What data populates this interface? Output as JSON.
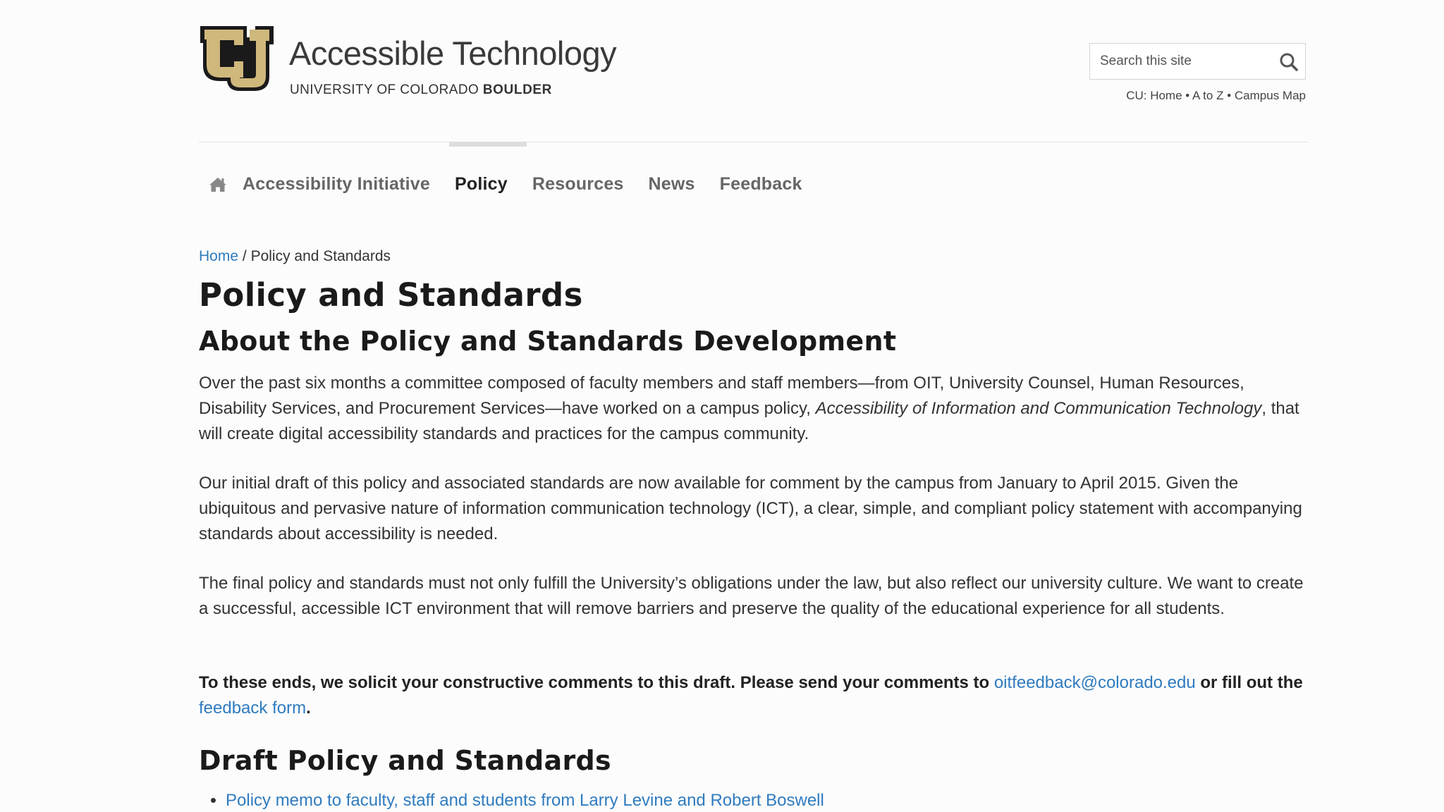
{
  "header": {
    "site_title": "Accessible Technology",
    "subtitle_prefix": "UNIVERSITY OF COLORADO ",
    "subtitle_strong": "BOULDER",
    "logo_icon": "cu-logo-icon",
    "search": {
      "placeholder": "Search this site",
      "button_icon": "search-icon"
    },
    "cu_links": {
      "prefix": "CU:",
      "items": [
        "Home",
        "A to Z",
        "Campus Map"
      ],
      "separator": "•"
    }
  },
  "nav": {
    "home_icon": "home-icon",
    "items": [
      {
        "label": "Accessibility Initiative",
        "active": false
      },
      {
        "label": "Policy",
        "active": true
      },
      {
        "label": "Resources",
        "active": false
      },
      {
        "label": "News",
        "active": false
      },
      {
        "label": "Feedback",
        "active": false
      }
    ]
  },
  "breadcrumb": {
    "home": "Home",
    "separator": "/",
    "current": "Policy and Standards"
  },
  "content": {
    "page_title": "Policy and Standards",
    "section1_heading": "About the Policy and Standards Development",
    "para1_before_italic": "Over the past six months a committee composed of faculty members and staff members—from OIT, University Counsel, Human Resources, Disability Services, and Procurement Services—have worked on a campus policy, ",
    "para1_italic": "Accessibility of Information and Communication Technology",
    "para1_after_italic": ", that will create digital accessibility standards and practices for the campus community.",
    "para2": "Our initial draft of this policy and associated standards are now available for comment by the campus from January to April 2015. Given the ubiquitous and pervasive nature of information communication technology (ICT), a clear, simple, and compliant policy statement with accompanying standards about accessibility is needed.",
    "para3": "The final policy and standards must not only fulfill the University’s obligations under the law, but also reflect our university culture. We want to create a successful, accessible ICT environment that will remove barriers and preserve the quality of the educational experience for all students.",
    "para4_before_email": "To these ends, we solicit your constructive comments to this draft. Please send your comments to ",
    "para4_email": "oitfeedback@colorado.edu",
    "para4_middle": " or fill out the ",
    "para4_link": "feedback form",
    "para4_end": ".",
    "section2_heading": "Draft Policy and Standards",
    "draft_items": [
      "Policy memo to faculty, staff and students from Larry Levine and Robert Boswell"
    ]
  },
  "colors": {
    "link": "#2f7bbf",
    "logo_gold": "#cfb87c",
    "logo_black": "#1a1a1a"
  }
}
